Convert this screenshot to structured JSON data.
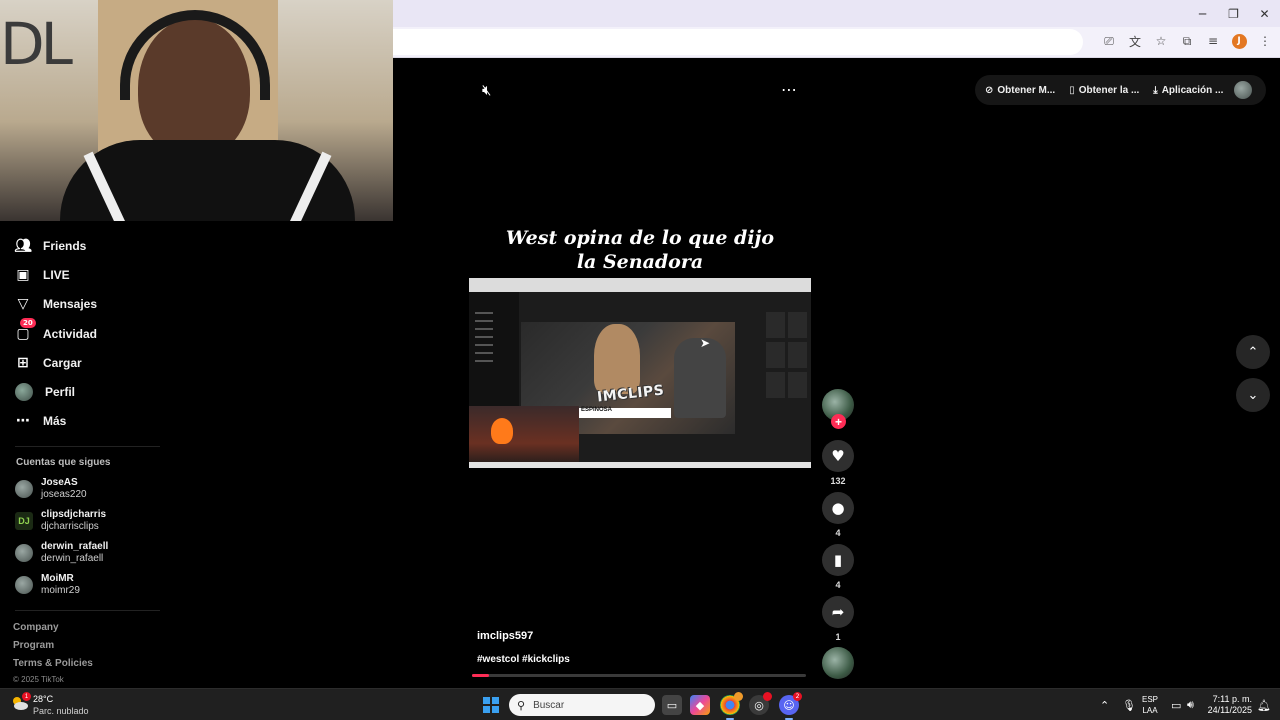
{
  "browser": {
    "window_controls": {
      "minimize": "─",
      "restore": "❐",
      "close": "✕"
    },
    "profile_initial": "J"
  },
  "sidebar": {
    "nav_items": [
      {
        "label": "Friends",
        "icon": "friends-icon"
      },
      {
        "label": "LIVE",
        "icon": "live-icon"
      },
      {
        "label": "Mensajes",
        "icon": "messages-icon"
      },
      {
        "label": "Actividad",
        "icon": "activity-icon",
        "badge": "20"
      },
      {
        "label": "Cargar",
        "icon": "upload-icon"
      },
      {
        "label": "Perfil",
        "icon": "profile-avatar"
      },
      {
        "label": "Más",
        "icon": "more-icon"
      }
    ],
    "following_title": "Cuentas que sigues",
    "following": [
      {
        "name": "JoseAS",
        "handle": "joseas220"
      },
      {
        "name": "clipsdjcharris",
        "handle": "djcharrisclips"
      },
      {
        "name": "derwin_rafaell",
        "handle": "derwin_rafaell"
      },
      {
        "name": "MoiMR",
        "handle": "moimr29"
      }
    ],
    "footer_links": [
      "Company",
      "Program",
      "Terms & Policies"
    ],
    "copyright": "© 2025 TikTok"
  },
  "top_actions": {
    "items": [
      "Obtener M...",
      "Obtener la ...",
      "Aplicación ..."
    ]
  },
  "video": {
    "title_line1": "West opina de lo que dijo",
    "title_line2": "la Senadora",
    "overlay_logo": "IMCLIPS",
    "lower_third": "ESPINOSA",
    "author": "imclips597",
    "hashtags": "#westcol #kickclips",
    "progress": 0.05
  },
  "actions": {
    "likes": "132",
    "comments": "4",
    "saves": "4",
    "shares": "1"
  },
  "taskbar": {
    "weather_temp": "28°C",
    "weather_desc": "Parc. nublado",
    "weather_badge": "1",
    "search_placeholder": "Buscar",
    "chrome_badge": "",
    "discord_badge": "2",
    "lang_line1": "ESP",
    "lang_line2": "LAA",
    "time": "7:11 p. m.",
    "date": "24/11/2025"
  }
}
